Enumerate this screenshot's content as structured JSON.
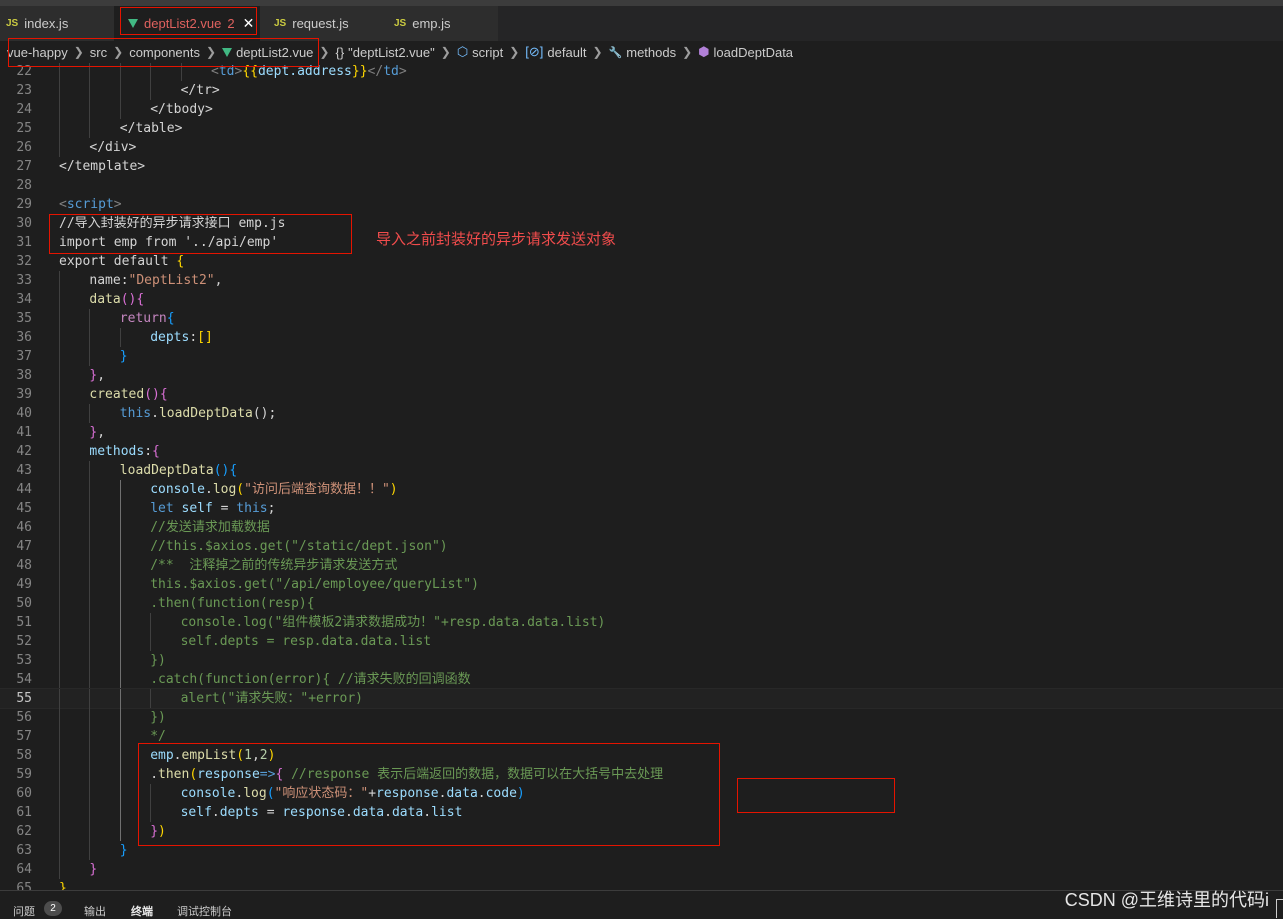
{
  "tabs": [
    {
      "icon": "js-file-icon",
      "icon_text": "JS",
      "label": "index.js"
    },
    {
      "icon": "vue-file-icon",
      "label": "deptList2.vue",
      "badge": "2",
      "close": "✕"
    },
    {
      "icon": "js-file-icon",
      "icon_text": "JS",
      "label": "request.js"
    },
    {
      "icon": "js-file-icon",
      "icon_text": "JS",
      "label": "emp.js"
    }
  ],
  "breadcrumb": {
    "items": [
      "vue-happy",
      "src",
      "components",
      "deptList2.vue",
      "\"deptList2.vue\"",
      "script",
      "default",
      "methods",
      "loadDeptData"
    ],
    "icons": {
      "object_icon": "{}",
      "script_icon": "⬡",
      "default_icon": "[⊘]",
      "methods_icon": "🔧",
      "loadDeptData_icon": "⬢"
    }
  },
  "annotation": "导入之前封装好的异步请求发送对象",
  "colors": {
    "red_box": "#e51400",
    "keyword": "#569cd6",
    "string": "#ce9178",
    "comment": "#6a9955",
    "function": "#dcdcaa",
    "variable": "#9cdcfe",
    "control": "#c586c0",
    "bracket_gold": "#ffd700",
    "bracket_pink": "#da70d6",
    "bracket_blue": "#179fff",
    "number": "#b5cea8"
  },
  "code_lines": [
    {
      "n": "22",
      "indent": 20,
      "tokens": [
        [
          "<",
          "#808080"
        ],
        [
          "td",
          "#569cd6"
        ],
        [
          ">",
          "#808080"
        ],
        [
          "{{",
          "#ffd700"
        ],
        [
          "dept.address",
          "#9cdcfe"
        ],
        [
          "}}",
          "#ffd700"
        ],
        [
          "</",
          "#808080"
        ],
        [
          "td",
          "#569cd6"
        ],
        [
          ">",
          "#808080"
        ]
      ]
    },
    {
      "n": "23",
      "indent": 16,
      "tokens": [
        [
          "</tr>",
          "#d4d4d4"
        ]
      ]
    },
    {
      "n": "24",
      "indent": 12,
      "tokens": [
        [
          "</tbody>",
          "#d4d4d4"
        ]
      ]
    },
    {
      "n": "25",
      "indent": 8,
      "tokens": [
        [
          "</table>",
          "#d4d4d4"
        ]
      ]
    },
    {
      "n": "26",
      "indent": 4,
      "tokens": [
        [
          "</div>",
          "#d4d4d4"
        ]
      ]
    },
    {
      "n": "27",
      "indent": 0,
      "tokens": [
        [
          "</template>",
          "#d4d4d4"
        ]
      ]
    },
    {
      "n": "28",
      "indent": 0,
      "tokens": []
    },
    {
      "n": "29",
      "indent": 0,
      "tokens": [
        [
          "<",
          "#808080"
        ],
        [
          "script",
          "#569cd6"
        ],
        [
          ">",
          "#808080"
        ]
      ]
    },
    {
      "n": "30",
      "indent": 0,
      "tokens": [
        [
          "//导入封装好的异步请求接口 emp.js",
          "#d4d4d4"
        ]
      ]
    },
    {
      "n": "31",
      "indent": 0,
      "tokens": [
        [
          "import emp from '../api/emp'",
          "#d4d4d4"
        ]
      ]
    },
    {
      "n": "32",
      "indent": 0,
      "tokens": [
        [
          "export default ",
          "#d4d4d4"
        ],
        [
          "{",
          "#ffd700"
        ]
      ]
    },
    {
      "n": "33",
      "indent": 4,
      "tokens": [
        [
          "name:",
          "#d4d4d4"
        ],
        [
          "\"DeptList2\"",
          "#ce9178"
        ],
        [
          ",",
          "#d4d4d4"
        ]
      ]
    },
    {
      "n": "34",
      "indent": 4,
      "tokens": [
        [
          "data",
          "#dcdcaa"
        ],
        [
          "(){",
          "#da70d6"
        ]
      ]
    },
    {
      "n": "35",
      "indent": 8,
      "tokens": [
        [
          "return",
          "#c586c0"
        ],
        [
          "{",
          "#179fff"
        ]
      ]
    },
    {
      "n": "36",
      "indent": 12,
      "tokens": [
        [
          "depts",
          "#9cdcfe"
        ],
        [
          ":",
          "#d4d4d4"
        ],
        [
          "[]",
          "#ffd700"
        ]
      ]
    },
    {
      "n": "37",
      "indent": 8,
      "tokens": [
        [
          "}",
          "#179fff"
        ]
      ]
    },
    {
      "n": "38",
      "indent": 4,
      "tokens": [
        [
          "}",
          "#da70d6"
        ],
        [
          ",",
          "#d4d4d4"
        ]
      ]
    },
    {
      "n": "39",
      "indent": 4,
      "tokens": [
        [
          "created",
          "#dcdcaa"
        ],
        [
          "(){",
          "#da70d6"
        ]
      ]
    },
    {
      "n": "40",
      "indent": 8,
      "tokens": [
        [
          "this",
          "#569cd6"
        ],
        [
          ".",
          "#d4d4d4"
        ],
        [
          "loadDeptData",
          "#dcdcaa"
        ],
        [
          "();",
          "#d4d4d4"
        ]
      ]
    },
    {
      "n": "41",
      "indent": 4,
      "tokens": [
        [
          "}",
          "#da70d6"
        ],
        [
          ",",
          "#d4d4d4"
        ]
      ]
    },
    {
      "n": "42",
      "indent": 4,
      "tokens": [
        [
          "methods",
          "#9cdcfe"
        ],
        [
          ":",
          "#d4d4d4"
        ],
        [
          "{",
          "#da70d6"
        ]
      ]
    },
    {
      "n": "43",
      "indent": 8,
      "tokens": [
        [
          "loadDeptData",
          "#dcdcaa"
        ],
        [
          "(){",
          "#179fff"
        ]
      ]
    },
    {
      "n": "44",
      "indent": 12,
      "tokens": [
        [
          "console",
          "#9cdcfe"
        ],
        [
          ".",
          "#d4d4d4"
        ],
        [
          "log",
          "#dcdcaa"
        ],
        [
          "(",
          "#ffd700"
        ],
        [
          "\"访问后端查询数据！！\"",
          "#ce9178"
        ],
        [
          ")",
          "#ffd700"
        ]
      ]
    },
    {
      "n": "45",
      "indent": 12,
      "tokens": [
        [
          "let ",
          "#569cd6"
        ],
        [
          "self",
          "#9cdcfe"
        ],
        [
          " = ",
          "#d4d4d4"
        ],
        [
          "this",
          "#569cd6"
        ],
        [
          ";",
          "#d4d4d4"
        ]
      ]
    },
    {
      "n": "46",
      "indent": 12,
      "tokens": [
        [
          "//发送请求加载数据",
          "#6a9955"
        ]
      ]
    },
    {
      "n": "47",
      "indent": 12,
      "tokens": [
        [
          "//this.$axios.get(\"/static/dept.json\")",
          "#6a9955"
        ]
      ]
    },
    {
      "n": "48",
      "indent": 12,
      "tokens": [
        [
          "/**  注释掉之前的传统异步请求发送方式",
          "#6a9955"
        ]
      ]
    },
    {
      "n": "49",
      "indent": 12,
      "tokens": [
        [
          "this.$axios.get(\"/api/employee/queryList\")",
          "#6a9955"
        ]
      ]
    },
    {
      "n": "50",
      "indent": 12,
      "tokens": [
        [
          ".then(function(resp){",
          "#6a9955"
        ]
      ]
    },
    {
      "n": "51",
      "indent": 16,
      "tokens": [
        [
          "console.log(\"组件模板2请求数据成功！\"+resp.data.data.list)",
          "#6a9955"
        ]
      ]
    },
    {
      "n": "52",
      "indent": 16,
      "tokens": [
        [
          "self.depts = resp.data.data.list",
          "#6a9955"
        ]
      ]
    },
    {
      "n": "53",
      "indent": 12,
      "tokens": [
        [
          "})",
          "#6a9955"
        ]
      ]
    },
    {
      "n": "54",
      "indent": 12,
      "tokens": [
        [
          ".catch(function(error){ //请求失败的回调函数",
          "#6a9955"
        ]
      ]
    },
    {
      "n": "55",
      "indent": 16,
      "tokens": [
        [
          "alert(\"请求失败：\"+error)",
          "#6a9955"
        ]
      ],
      "current": true
    },
    {
      "n": "56",
      "indent": 12,
      "tokens": [
        [
          "})",
          "#6a9955"
        ]
      ]
    },
    {
      "n": "57",
      "indent": 12,
      "tokens": [
        [
          "*/",
          "#6a9955"
        ]
      ]
    },
    {
      "n": "58",
      "indent": 12,
      "tokens": [
        [
          "emp",
          "#9cdcfe"
        ],
        [
          ".",
          "#d4d4d4"
        ],
        [
          "empList",
          "#dcdcaa"
        ],
        [
          "(",
          "#ffd700"
        ],
        [
          "1",
          "#b5cea8"
        ],
        [
          ",",
          "#d4d4d4"
        ],
        [
          "2",
          "#b5cea8"
        ],
        [
          ")",
          "#ffd700"
        ]
      ]
    },
    {
      "n": "59",
      "indent": 12,
      "tokens": [
        [
          ".",
          "#d4d4d4"
        ],
        [
          "then",
          "#dcdcaa"
        ],
        [
          "(",
          "#ffd700"
        ],
        [
          "response",
          "#9cdcfe"
        ],
        [
          "=>",
          "#569cd6"
        ],
        [
          "{",
          "#da70d6"
        ],
        [
          " //response 表示后端返回的数据，数据可以在大括号中去处理",
          "#6a9955"
        ]
      ]
    },
    {
      "n": "60",
      "indent": 16,
      "tokens": [
        [
          "console",
          "#9cdcfe"
        ],
        [
          ".",
          "#d4d4d4"
        ],
        [
          "log",
          "#dcdcaa"
        ],
        [
          "(",
          "#179fff"
        ],
        [
          "\"响应状态码：\"",
          "#ce9178"
        ],
        [
          "+",
          "#d4d4d4"
        ],
        [
          "response",
          "#9cdcfe"
        ],
        [
          ".",
          "#d4d4d4"
        ],
        [
          "data",
          "#9cdcfe"
        ],
        [
          ".",
          "#d4d4d4"
        ],
        [
          "code",
          "#9cdcfe"
        ],
        [
          ")",
          "#179fff"
        ]
      ]
    },
    {
      "n": "61",
      "indent": 16,
      "tokens": [
        [
          "self",
          "#9cdcfe"
        ],
        [
          ".",
          "#d4d4d4"
        ],
        [
          "depts",
          "#9cdcfe"
        ],
        [
          " = ",
          "#d4d4d4"
        ],
        [
          "response",
          "#9cdcfe"
        ],
        [
          ".",
          "#d4d4d4"
        ],
        [
          "data",
          "#9cdcfe"
        ],
        [
          ".",
          "#d4d4d4"
        ],
        [
          "data",
          "#9cdcfe"
        ],
        [
          ".",
          "#d4d4d4"
        ],
        [
          "list",
          "#9cdcfe"
        ]
      ]
    },
    {
      "n": "62",
      "indent": 12,
      "tokens": [
        [
          "}",
          "#da70d6"
        ],
        [
          ")",
          "#ffd700"
        ]
      ]
    },
    {
      "n": "63",
      "indent": 8,
      "tokens": [
        [
          "}",
          "#179fff"
        ]
      ]
    },
    {
      "n": "64",
      "indent": 4,
      "tokens": [
        [
          "}",
          "#da70d6"
        ]
      ]
    },
    {
      "n": "65",
      "indent": 0,
      "tokens": [
        [
          "}",
          "#ffd700"
        ]
      ]
    }
  ],
  "panel": {
    "tabs": [
      "问题",
      "输出",
      "终端",
      "调试控制台"
    ],
    "problems_count": "2"
  },
  "watermark": "CSDN @王维诗里的代码i"
}
